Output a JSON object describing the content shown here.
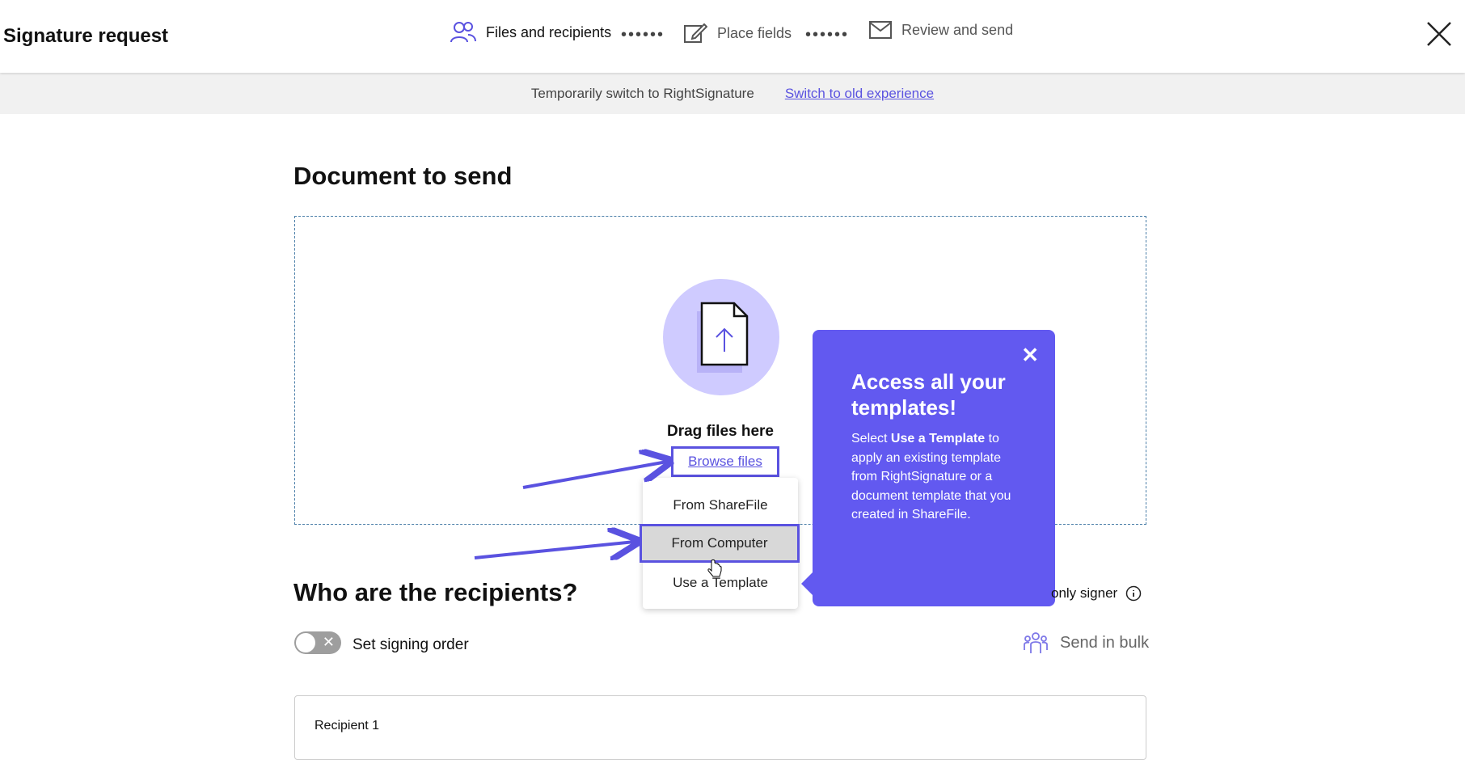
{
  "header": {
    "title": "Signature request",
    "steps": [
      {
        "label": "Files and recipients",
        "icon": "users-icon",
        "active": true
      },
      {
        "label": "Place fields",
        "icon": "edit-icon",
        "active": false
      },
      {
        "label": "Review and send",
        "icon": "envelope-icon",
        "active": false
      }
    ],
    "separator": "••••••"
  },
  "banner": {
    "text": "Temporarily switch to RightSignature",
    "link": "Switch to old experience"
  },
  "document": {
    "heading": "Document to send",
    "drag_text": "Drag files here",
    "browse_link": "Browse files"
  },
  "browse_menu": {
    "items": [
      "From ShareFile",
      "From Computer",
      "Use a Template"
    ],
    "selected": "From Computer"
  },
  "popover": {
    "title": "Access all your templates!",
    "body_prefix": "Select ",
    "body_bold": "Use a Template",
    "body_suffix": " to apply an existing template from RightSignature or a document template that you created in ShareFile."
  },
  "recipients": {
    "heading": "Who are the recipients?",
    "only_signer": "only signer",
    "signing_order": "Set signing order",
    "send_in_bulk": "Send in bulk",
    "recipient_1": "Recipient 1"
  },
  "colors": {
    "accent": "#5a52e0",
    "popover_bg": "#6259f0",
    "upload_circle": "#cfcbff"
  }
}
